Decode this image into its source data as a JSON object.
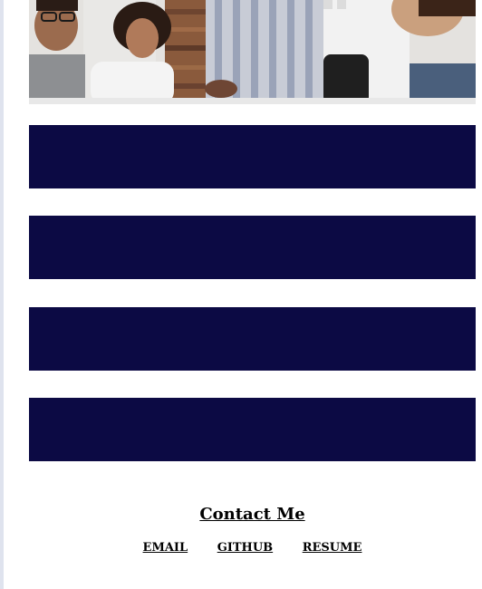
{
  "hero": {
    "image": "team-meeting-photo"
  },
  "blocks": [
    {
      "color": "#0c0a44"
    },
    {
      "color": "#0c0a44"
    },
    {
      "color": "#0c0a44"
    },
    {
      "color": "#0c0a44"
    }
  ],
  "contact": {
    "heading": "Contact Me",
    "links": {
      "email": "EMAIL",
      "github": "GITHUB",
      "resume": "RESUME"
    }
  }
}
